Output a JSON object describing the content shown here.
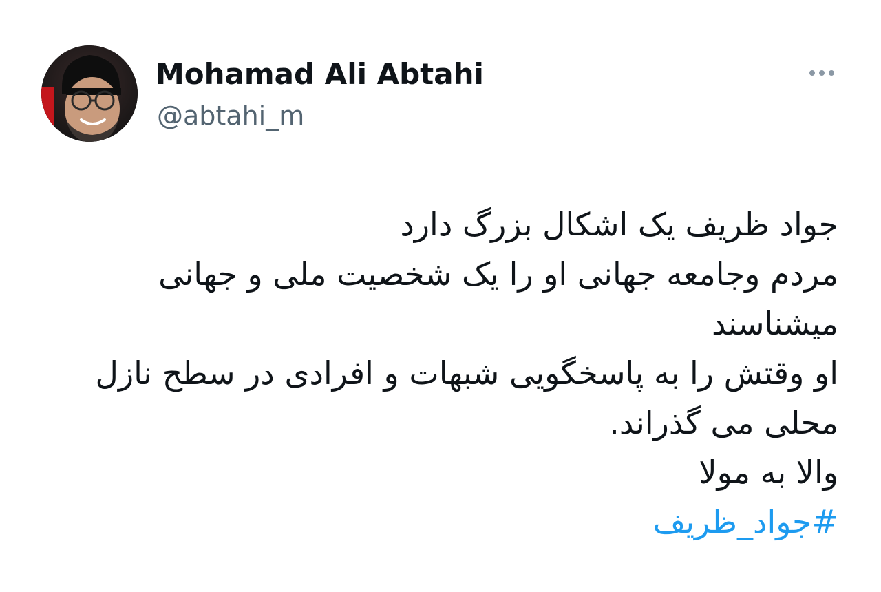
{
  "author": {
    "name": "Mohamad Ali Abtahi",
    "handle": "@abtahi_m",
    "avatar_icon": "profile-photo"
  },
  "menu": {
    "icon": "more-horizontal-icon"
  },
  "tweet": {
    "lines": [
      "جواد ظریف یک اشکال بزرگ دارد",
      "مردم وجامعه جهانی او را یک شخصیت ملی و جهانی",
      "میشناسند",
      "او وقتش را به پاسخگویی شبهات و افرادی در سطح نازل",
      "محلی می گذراند.",
      "والا به مولا"
    ],
    "hashtag": "#جواد_ظریف"
  },
  "colors": {
    "text": "#0f1419",
    "secondary": "#536471",
    "link": "#1d9bf0",
    "background": "#ffffff"
  }
}
